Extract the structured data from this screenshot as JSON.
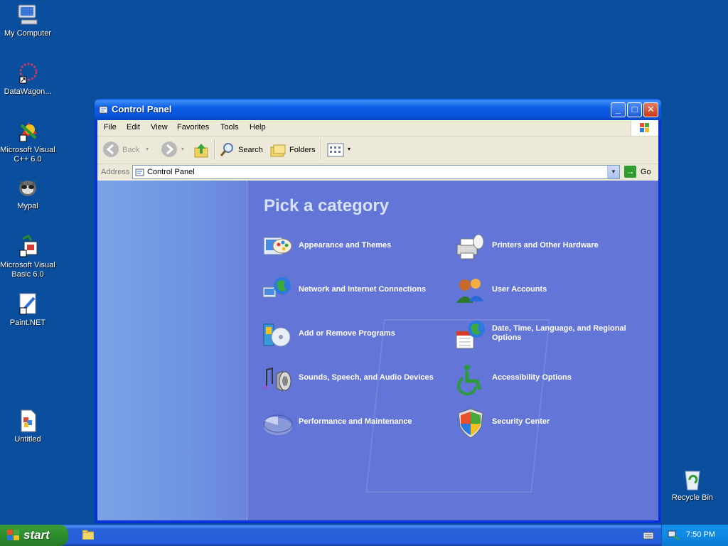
{
  "desktop": {
    "icons": [
      {
        "label": "My Computer",
        "icon": "my-computer-icon"
      },
      {
        "label": "DataWagon...",
        "icon": "datawagon-icon"
      },
      {
        "label": "Microsoft Visual C++ 6.0",
        "icon": "visual-cpp-icon"
      },
      {
        "label": "Mypal",
        "icon": "mypal-icon"
      },
      {
        "label": "Microsoft Visual Basic 6.0",
        "icon": "visual-basic-icon"
      },
      {
        "label": "Paint.NET",
        "icon": "paintnet-icon"
      },
      {
        "label": "Untitled",
        "icon": "untitled-document-icon"
      },
      {
        "label": "Recycle Bin",
        "icon": "recycle-bin-icon"
      }
    ]
  },
  "window": {
    "title": "Control Panel",
    "menu": [
      "File",
      "Edit",
      "View",
      "Favorites",
      "Tools",
      "Help"
    ],
    "toolbar": {
      "back": "Back",
      "search": "Search",
      "folders": "Folders"
    },
    "address": {
      "label": "Address",
      "value": "Control Panel",
      "go": "Go"
    },
    "content": {
      "heading": "Pick a category",
      "categories": [
        {
          "label": "Appearance and Themes",
          "icon": "appearance-themes-icon"
        },
        {
          "label": "Printers and Other Hardware",
          "icon": "printers-hardware-icon"
        },
        {
          "label": "Network and Internet Connections",
          "icon": "network-internet-icon"
        },
        {
          "label": "User Accounts",
          "icon": "user-accounts-icon"
        },
        {
          "label": "Add or Remove Programs",
          "icon": "add-remove-programs-icon"
        },
        {
          "label": "Date, Time, Language, and Regional Options",
          "icon": "date-time-language-icon"
        },
        {
          "label": "Sounds, Speech, and Audio Devices",
          "icon": "sounds-audio-icon"
        },
        {
          "label": "Accessibility Options",
          "icon": "accessibility-icon"
        },
        {
          "label": "Performance and Maintenance",
          "icon": "performance-maintenance-icon"
        },
        {
          "label": "Security Center",
          "icon": "security-center-icon"
        }
      ]
    }
  },
  "taskbar": {
    "start": "start",
    "clock": "7:50 PM"
  },
  "colors": {
    "desktop": "#0a4f9e",
    "titlebar": "#0a5be6",
    "content_bg": "#6375d6",
    "start_green": "#3c9c3c"
  }
}
